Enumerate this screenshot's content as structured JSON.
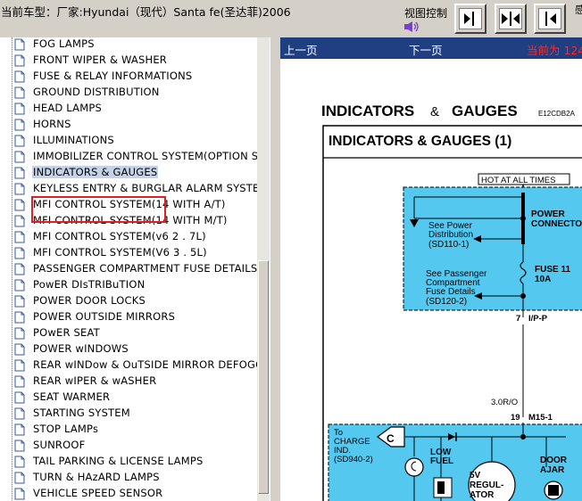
{
  "window": {
    "title": "当前车型：厂家:Hyundai（现代）Santa fe(圣达菲)2006",
    "view_control_label": "视图控制",
    "edge_glyph": "感"
  },
  "sidebar": {
    "items": [
      {
        "label": "FOG LAMPS"
      },
      {
        "label": "FRONT WIPER & WASHER"
      },
      {
        "label": "FUSE & RELAY INFORMATIONS"
      },
      {
        "label": "GROUND DISTRIBUTION"
      },
      {
        "label": "HEAD LAMPS"
      },
      {
        "label": "HORNS"
      },
      {
        "label": "ILLUMINATIONS"
      },
      {
        "label": "IMMOBILIZER CONTROL SYSTEM(OPTION S"
      },
      {
        "label": "INDICATORS & GAUGES",
        "selected": true
      },
      {
        "label": "KEYLESS ENTRY & BURGLAR ALARM SYSTE"
      },
      {
        "label": "MFI CONTROL SYSTEM(14 WITH A/T)"
      },
      {
        "label": "MFI CONTROL SYSTEM(14 WITH M/T)"
      },
      {
        "label": "MFI CONTROL SYSTEM(v6 2 . 7L)"
      },
      {
        "label": "MFI CONTROL SYSTEM(V6 3 . 5L)"
      },
      {
        "label": "PASSENGER COMPARTMENT FUSE DETAILS"
      },
      {
        "label": "PowER DIsTRIBuTION"
      },
      {
        "label": "POWER DOOR LOCKS"
      },
      {
        "label": "POWER OUTSIDE MIRRORS"
      },
      {
        "label": "POwER SEAT"
      },
      {
        "label": "POWER wINDOWS"
      },
      {
        "label": "REAR wINDow & OuTSIDE MIRROR DEFOGG"
      },
      {
        "label": "REAR wIPER & wASHER"
      },
      {
        "label": "SEAT WARMER"
      },
      {
        "label": "STARTING SYSTEM"
      },
      {
        "label": "STOP LAMPs"
      },
      {
        "label": "SUNROOF"
      },
      {
        "label": "TAIL PARKING & LICENSE LAMPS"
      },
      {
        "label": "TURN & HAzARD LAMPS"
      },
      {
        "label": "VEHICLE SPEED SENSOR"
      }
    ]
  },
  "nav": {
    "prev": "上一页",
    "next": "下一页",
    "current": "当前为 124"
  },
  "diagram": {
    "header": "INDICATORS",
    "header_amp": "&",
    "header2": "GAUGES",
    "code": "E12CDB2A",
    "box_title": "INDICATORS & GAUGES (1)",
    "hot": "HOT AT ALL TIMES",
    "see_power_1": "See Power",
    "see_power_2": "Distribution",
    "see_power_3": "(SD110-1)",
    "power_conn_1": "POWER",
    "power_conn_2": "CONNECTO",
    "fuse_1": "FUSE 11",
    "fuse_2": "10A",
    "see_pass_1": "See Passenger",
    "see_pass_2": "Compartment",
    "see_pass_3": "Fuse Details",
    "see_pass_4": "(SD120-2)",
    "ip_num": "7",
    "ip_label": "I/P-P",
    "wire": "3.0R/O",
    "m15_num": "19",
    "m15_label": "M15-1",
    "to_1": "To",
    "to_2": "CHARGE",
    "to_3": "IND.",
    "to_4": "(SD940-2)",
    "c_letter": "C",
    "low_1": "LOW",
    "low_2": "FUEL",
    "five_1": "5V",
    "five_2": "REGUL-",
    "five_3": "ATOR",
    "door_1": "DOOR",
    "door_2": "AJAR"
  },
  "colors": {
    "navbar": "#1f3f82",
    "highlight_fill": "#55c8f0",
    "selection_box": "#e02020",
    "current_page": "#ff2828"
  }
}
